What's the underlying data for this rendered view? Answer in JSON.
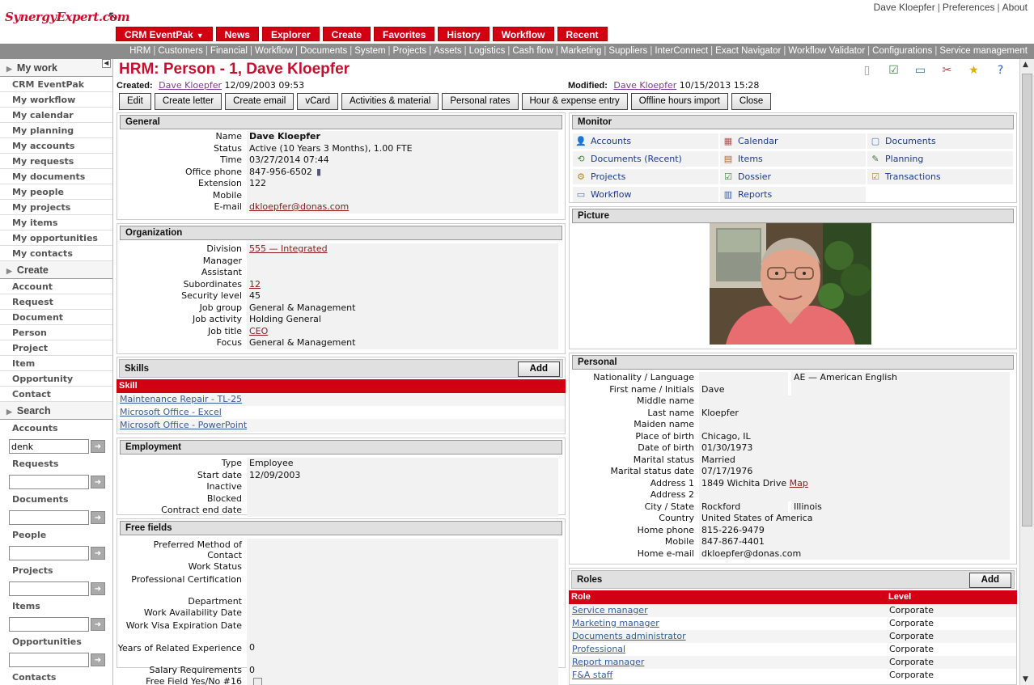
{
  "top": {
    "logo": "SynergyExpert.com",
    "user": "Dave Kloepfer",
    "preferences": "Preferences",
    "about": "About"
  },
  "mainnav": [
    "CRM EventPak",
    "News",
    "Explorer",
    "Create",
    "Favorites",
    "History",
    "Workflow",
    "Recent"
  ],
  "subnav": [
    "HRM",
    "Customers",
    "Financial",
    "Workflow",
    "Documents",
    "System",
    "Projects",
    "Assets",
    "Logistics",
    "Cash flow",
    "Marketing",
    "Suppliers",
    "InterConnect",
    "Exact Navigator",
    "Workflow Validator",
    "Configurations",
    "Service management"
  ],
  "sidebar": {
    "mywork_title": "My work",
    "mywork": [
      "CRM EventPak",
      "My workflow",
      "My calendar",
      "My planning",
      "My accounts",
      "My requests",
      "My documents",
      "My people",
      "My projects",
      "My items",
      "My opportunities",
      "My contacts"
    ],
    "create_title": "Create",
    "create": [
      "Account",
      "Request",
      "Document",
      "Person",
      "Project",
      "Item",
      "Opportunity",
      "Contact"
    ],
    "search_title": "Search",
    "search": [
      {
        "label": "Accounts",
        "value": "denk"
      },
      {
        "label": "Requests",
        "value": ""
      },
      {
        "label": "Documents",
        "value": ""
      },
      {
        "label": "People",
        "value": ""
      },
      {
        "label": "Projects",
        "value": ""
      },
      {
        "label": "Items",
        "value": ""
      },
      {
        "label": "Opportunities",
        "value": ""
      },
      {
        "label": "Contacts",
        "value": ""
      }
    ]
  },
  "page": {
    "title": "HRM: Person - 1, Dave Kloepfer",
    "created_label": "Created:",
    "created_by": "Dave Kloepfer",
    "created_date": "12/09/2003 09:53",
    "modified_label": "Modified:",
    "modified_by": "Dave Kloepfer",
    "modified_date": "10/15/2013 15:28",
    "actions": [
      "Edit",
      "Create letter",
      "Create email",
      "vCard",
      "Activities & material",
      "Personal rates",
      "Hour & expense entry",
      "Offline hours import",
      "Close"
    ]
  },
  "general": {
    "title": "General",
    "rows": [
      {
        "label": "Name",
        "value": "Dave Kloepfer"
      },
      {
        "label": "Status",
        "value": "Active (10 Years 3 Months), 1.00 FTE"
      },
      {
        "label": "Time",
        "value": "03/27/2014 07:44"
      },
      {
        "label": "Office phone",
        "value": "847-956-6502"
      },
      {
        "label": "Extension",
        "value": "122"
      },
      {
        "label": "Mobile",
        "value": ""
      },
      {
        "label": "E-mail",
        "value": "dkloepfer@donas.com"
      }
    ]
  },
  "organization": {
    "title": "Organization",
    "rows": [
      {
        "label": "Division",
        "value": "555 — Integrated"
      },
      {
        "label": "Manager",
        "value": ""
      },
      {
        "label": "Assistant",
        "value": ""
      },
      {
        "label": "Subordinates",
        "value": "12"
      },
      {
        "label": "Security level",
        "value": "45"
      },
      {
        "label": "Job group",
        "value": "General & Management"
      },
      {
        "label": "Job activity",
        "value": "Holding General"
      },
      {
        "label": "Job title",
        "value": "CEO"
      },
      {
        "label": "Focus",
        "value": "General & Management"
      }
    ]
  },
  "skills": {
    "title": "Skills",
    "add": "Add",
    "column": "Skill",
    "items": [
      "Maintenance Repair - TL-25",
      "Microsoft Office - Excel",
      "Microsoft Office - PowerPoint"
    ]
  },
  "employment": {
    "title": "Employment",
    "rows": [
      {
        "label": "Type",
        "value": "Employee"
      },
      {
        "label": "Start date",
        "value": "12/09/2003"
      },
      {
        "label": "Inactive",
        "value": ""
      },
      {
        "label": "Blocked",
        "value": ""
      },
      {
        "label": "Contract end date",
        "value": ""
      }
    ]
  },
  "freefields": {
    "title": "Free fields",
    "rows": [
      {
        "label": "Preferred Method of Contact",
        "value": ""
      },
      {
        "label": "Work Status",
        "value": ""
      },
      {
        "label": "Professional Certification",
        "value": ""
      },
      {
        "label": "Department",
        "value": ""
      },
      {
        "label": "Work Availability Date",
        "value": ""
      },
      {
        "label": "Work Visa Expiration Date",
        "value": ""
      },
      {
        "label": "Years of Related Experience",
        "value": "0"
      },
      {
        "label": "Salary Requirements",
        "value": "0"
      },
      {
        "label": "Free Field Yes/No #16",
        "value": ""
      }
    ]
  },
  "monitor": {
    "title": "Monitor",
    "items": [
      {
        "label": "Accounts",
        "icon": "accounts-icon",
        "glyph": "👤",
        "color": "#c89a1a"
      },
      {
        "label": "Calendar",
        "icon": "calendar-icon",
        "glyph": "▦",
        "color": "#b05050"
      },
      {
        "label": "Documents",
        "icon": "documents-icon",
        "glyph": "▢",
        "color": "#5070b0"
      },
      {
        "label": "Documents (Recent)",
        "icon": "documents-recent-icon",
        "glyph": "⟲",
        "color": "#3a8a3a"
      },
      {
        "label": "Items",
        "icon": "items-icon",
        "glyph": "▤",
        "color": "#b06020"
      },
      {
        "label": "Planning",
        "icon": "planning-icon",
        "glyph": "✎",
        "color": "#507050"
      },
      {
        "label": "Projects",
        "icon": "projects-icon",
        "glyph": "⚙",
        "color": "#b08a20"
      },
      {
        "label": "Dossier",
        "icon": "dossier-icon",
        "glyph": "☑",
        "color": "#3a8a3a"
      },
      {
        "label": "Transactions",
        "icon": "transactions-icon",
        "glyph": "☑",
        "color": "#b08a20"
      },
      {
        "label": "Workflow",
        "icon": "workflow-icon",
        "glyph": "▭",
        "color": "#4a70b0"
      },
      {
        "label": "Reports",
        "icon": "reports-icon",
        "glyph": "▥",
        "color": "#3a60b0"
      }
    ]
  },
  "picture": {
    "title": "Picture"
  },
  "personal": {
    "title": "Personal",
    "rows": [
      {
        "label": "Nationality / Language",
        "value": "",
        "value2": "AE — American English"
      },
      {
        "label": "First name / Initials",
        "value": "Dave",
        "value2": ""
      },
      {
        "label": "Middle name",
        "value": ""
      },
      {
        "label": "Last name",
        "value": "Kloepfer"
      },
      {
        "label": "Maiden name",
        "value": ""
      },
      {
        "label": "Place of birth",
        "value": "Chicago, IL"
      },
      {
        "label": "Date of birth",
        "value": "01/30/1973"
      },
      {
        "label": "Marital status",
        "value": "Married"
      },
      {
        "label": "Marital status date",
        "value": "07/17/1976"
      },
      {
        "label": "Address 1",
        "value": "1849 Wichita Drive",
        "link": "Map"
      },
      {
        "label": "Address 2",
        "value": ""
      },
      {
        "label": "City / State",
        "value": "Rockford",
        "value2": "Illinois"
      },
      {
        "label": "Country",
        "value": "United States of America"
      },
      {
        "label": "Home phone",
        "value": "815-226-9479"
      },
      {
        "label": "Mobile",
        "value": "847-867-4401"
      },
      {
        "label": "Home e-mail",
        "value": "dkloepfer@donas.com"
      }
    ]
  },
  "roles": {
    "title": "Roles",
    "add": "Add",
    "col_role": "Role",
    "col_level": "Level",
    "items": [
      {
        "role": "Service manager",
        "level": "Corporate"
      },
      {
        "role": "Marketing manager",
        "level": "Corporate"
      },
      {
        "role": "Documents administrator",
        "level": "Corporate"
      },
      {
        "role": "Professional",
        "level": "Corporate"
      },
      {
        "role": "Report manager",
        "level": "Corporate"
      },
      {
        "role": "F&A staff",
        "level": "Corporate"
      }
    ]
  },
  "colors": {
    "brand_red": "#d10012",
    "title_red": "#c8102e",
    "link": "#8b1a1a",
    "monitor_link": "#1a3a8b"
  }
}
